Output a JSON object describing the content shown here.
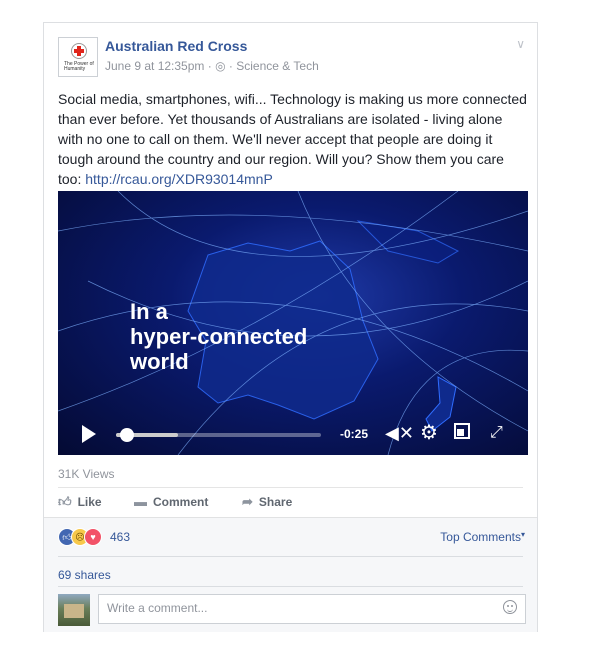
{
  "post": {
    "author": "Australian Red Cross",
    "logo_text": "The Power of Humanity",
    "date": "June 9 at 12:35pm",
    "separator": "·",
    "globe_icon": "globe-icon",
    "category": "· Science & Tech",
    "body": "Social media, smartphones, wifi... Technology is making us more connected than ever before. Yet thousands of Australians are isolated - living alone with no one to call on them. We'll never accept that people are doing it tough around the country and our region. Will you? Show them you care too:",
    "link": "http://rcau.org/XDR93014mnP"
  },
  "video": {
    "overlay": "In a\nhyper-connected\nworld",
    "time_remaining": "-0:25",
    "progress": 0.3
  },
  "stats": {
    "views": "31K Views"
  },
  "actions": {
    "like": "Like",
    "comment": "Comment",
    "share": "Share"
  },
  "reactions": {
    "count": "463",
    "top_comments": "Top Comments",
    "shares": "69 shares"
  },
  "comment_box": {
    "placeholder": "Write a comment..."
  },
  "colors": {
    "link": "#365899",
    "like_blue": "#4267b2",
    "love_red": "#f25268",
    "sad_yellow": "#f7c84b"
  }
}
